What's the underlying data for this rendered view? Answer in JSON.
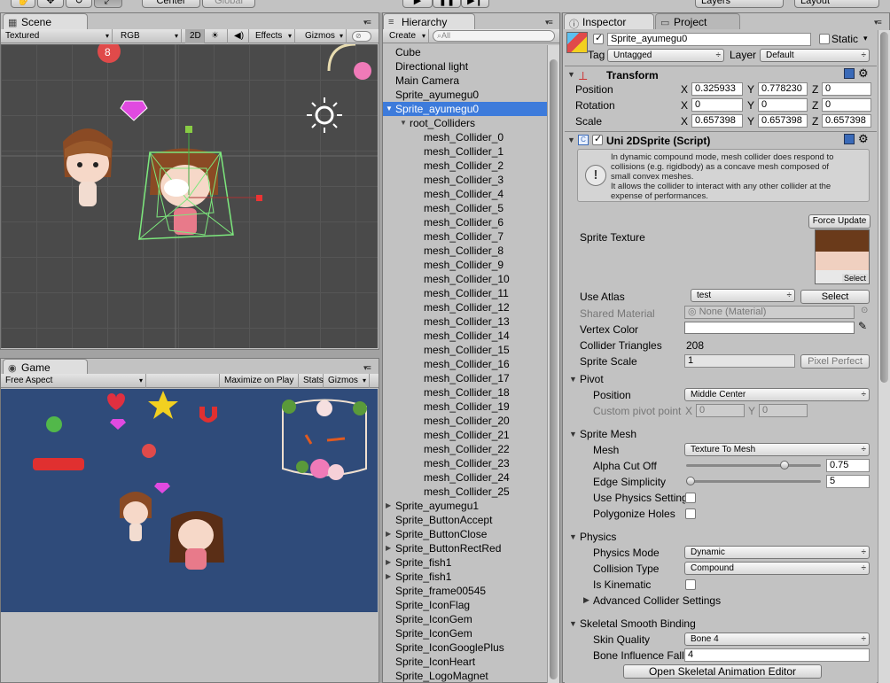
{
  "toolbar": {
    "pivot_mode": "Center",
    "pivot_rotation": "Global",
    "layers": "Layers",
    "layout": "Layout"
  },
  "scene": {
    "tab": "Scene",
    "shading": "Textured",
    "render_mode": "RGB",
    "mode_2d": "2D",
    "effects": "Effects",
    "gizmos": "Gizmos",
    "search_placeholder": ""
  },
  "game": {
    "tab": "Game",
    "aspect": "Free Aspect",
    "maximize": "Maximize on Play",
    "stats": "Stats",
    "gizmos": "Gizmos"
  },
  "hierarchy": {
    "tab": "Hierarchy",
    "create": "Create",
    "search_placeholder": "All",
    "rows": [
      {
        "label": "Cube",
        "indent": 0,
        "arrow": ""
      },
      {
        "label": "Directional light",
        "indent": 0,
        "arrow": ""
      },
      {
        "label": "Main Camera",
        "indent": 0,
        "arrow": ""
      },
      {
        "label": "Sprite_ayumegu0",
        "indent": 0,
        "arrow": ""
      },
      {
        "label": "Sprite_ayumegu0",
        "indent": 0,
        "arrow": "open",
        "selected": true
      },
      {
        "label": "root_Colliders",
        "indent": 1,
        "arrow": "open"
      },
      {
        "label": "mesh_Collider_0",
        "indent": 2,
        "arrow": ""
      },
      {
        "label": "mesh_Collider_1",
        "indent": 2,
        "arrow": ""
      },
      {
        "label": "mesh_Collider_2",
        "indent": 2,
        "arrow": ""
      },
      {
        "label": "mesh_Collider_3",
        "indent": 2,
        "arrow": ""
      },
      {
        "label": "mesh_Collider_4",
        "indent": 2,
        "arrow": ""
      },
      {
        "label": "mesh_Collider_5",
        "indent": 2,
        "arrow": ""
      },
      {
        "label": "mesh_Collider_6",
        "indent": 2,
        "arrow": ""
      },
      {
        "label": "mesh_Collider_7",
        "indent": 2,
        "arrow": ""
      },
      {
        "label": "mesh_Collider_8",
        "indent": 2,
        "arrow": ""
      },
      {
        "label": "mesh_Collider_9",
        "indent": 2,
        "arrow": ""
      },
      {
        "label": "mesh_Collider_10",
        "indent": 2,
        "arrow": ""
      },
      {
        "label": "mesh_Collider_11",
        "indent": 2,
        "arrow": ""
      },
      {
        "label": "mesh_Collider_12",
        "indent": 2,
        "arrow": ""
      },
      {
        "label": "mesh_Collider_13",
        "indent": 2,
        "arrow": ""
      },
      {
        "label": "mesh_Collider_14",
        "indent": 2,
        "arrow": ""
      },
      {
        "label": "mesh_Collider_15",
        "indent": 2,
        "arrow": ""
      },
      {
        "label": "mesh_Collider_16",
        "indent": 2,
        "arrow": ""
      },
      {
        "label": "mesh_Collider_17",
        "indent": 2,
        "arrow": ""
      },
      {
        "label": "mesh_Collider_18",
        "indent": 2,
        "arrow": ""
      },
      {
        "label": "mesh_Collider_19",
        "indent": 2,
        "arrow": ""
      },
      {
        "label": "mesh_Collider_20",
        "indent": 2,
        "arrow": ""
      },
      {
        "label": "mesh_Collider_21",
        "indent": 2,
        "arrow": ""
      },
      {
        "label": "mesh_Collider_22",
        "indent": 2,
        "arrow": ""
      },
      {
        "label": "mesh_Collider_23",
        "indent": 2,
        "arrow": ""
      },
      {
        "label": "mesh_Collider_24",
        "indent": 2,
        "arrow": ""
      },
      {
        "label": "mesh_Collider_25",
        "indent": 2,
        "arrow": ""
      },
      {
        "label": "Sprite_ayumegu1",
        "indent": 0,
        "arrow": "closed"
      },
      {
        "label": "Sprite_ButtonAccept",
        "indent": 0,
        "arrow": ""
      },
      {
        "label": "Sprite_ButtonClose",
        "indent": 0,
        "arrow": "closed"
      },
      {
        "label": "Sprite_ButtonRectRed",
        "indent": 0,
        "arrow": "closed"
      },
      {
        "label": "Sprite_fish1",
        "indent": 0,
        "arrow": "closed"
      },
      {
        "label": "Sprite_fish1",
        "indent": 0,
        "arrow": "closed"
      },
      {
        "label": "Sprite_frame00545",
        "indent": 0,
        "arrow": ""
      },
      {
        "label": "Sprite_IconFlag",
        "indent": 0,
        "arrow": ""
      },
      {
        "label": "Sprite_IconGem",
        "indent": 0,
        "arrow": ""
      },
      {
        "label": "Sprite_IconGem",
        "indent": 0,
        "arrow": ""
      },
      {
        "label": "Sprite_IconGooglePlus",
        "indent": 0,
        "arrow": ""
      },
      {
        "label": "Sprite_IconHeart",
        "indent": 0,
        "arrow": ""
      },
      {
        "label": "Sprite_LogoMagnet",
        "indent": 0,
        "arrow": ""
      }
    ]
  },
  "inspector": {
    "tab": "Inspector",
    "project_tab": "Project",
    "object_name": "Sprite_ayumegu0",
    "static_label": "Static",
    "tag_label": "Tag",
    "tag_value": "Untagged",
    "layer_label": "Layer",
    "layer_value": "Default",
    "transform": {
      "title": "Transform",
      "position_label": "Position",
      "position": [
        "0.325933",
        "0.778230",
        "0"
      ],
      "rotation_label": "Rotation",
      "rotation": [
        "0",
        "0",
        "0"
      ],
      "scale_label": "Scale",
      "scale": [
        "0.657398",
        "0.657398",
        "0.657398"
      ],
      "x": "X",
      "y": "Y",
      "z": "Z"
    },
    "script": {
      "title": "Uni 2DSprite (Script)",
      "help_lines": [
        "In dynamic compound mode, mesh collider does respond to",
        "collisions (e.g. rigidbody) as a concave mesh composed of",
        "small convex meshes.",
        "It allows the collider to interact with any other collider at the",
        "expense of performances."
      ],
      "force_update": "Force Update",
      "sprite_texture": "Sprite Texture",
      "texture_select": "Select",
      "use_atlas": "Use Atlas",
      "atlas_value": "test",
      "atlas_select": "Select",
      "shared_material": "Shared Material",
      "shared_material_value": "None (Material)",
      "vertex_color": "Vertex Color",
      "collider_triangles": "Collider Triangles",
      "collider_triangles_value": "208",
      "sprite_scale": "Sprite Scale",
      "sprite_scale_value": "1",
      "pixel_perfect": "Pixel Perfect",
      "pivot": "Pivot",
      "pivot_position": "Position",
      "pivot_position_value": "Middle Center",
      "custom_pivot": "Custom pivot point",
      "custom_pivot_x": "0",
      "custom_pivot_y": "0",
      "sprite_mesh": "Sprite Mesh",
      "mesh": "Mesh",
      "mesh_value": "Texture To Mesh",
      "alpha_cut_off": "Alpha Cut Off",
      "alpha_cut_off_value": "0.75",
      "edge_simplicity": "Edge Simplicity",
      "edge_simplicity_value": "5",
      "use_physics_settings": "Use Physics Setting",
      "polygonize_holes": "Polygonize Holes",
      "physics": "Physics",
      "physics_mode": "Physics Mode",
      "physics_mode_value": "Dynamic",
      "collision_type": "Collision Type",
      "collision_type_value": "Compound",
      "is_kinematic": "Is Kinematic",
      "advanced_collider": "Advanced Collider Settings",
      "skeletal": "Skeletal Smooth Binding",
      "skin_quality": "Skin Quality",
      "skin_quality_value": "Bone 4",
      "bone_influence": "Bone Influence Falloff",
      "bone_influence_value": "4",
      "open_editor": "Open Skeletal Animation Editor"
    }
  }
}
